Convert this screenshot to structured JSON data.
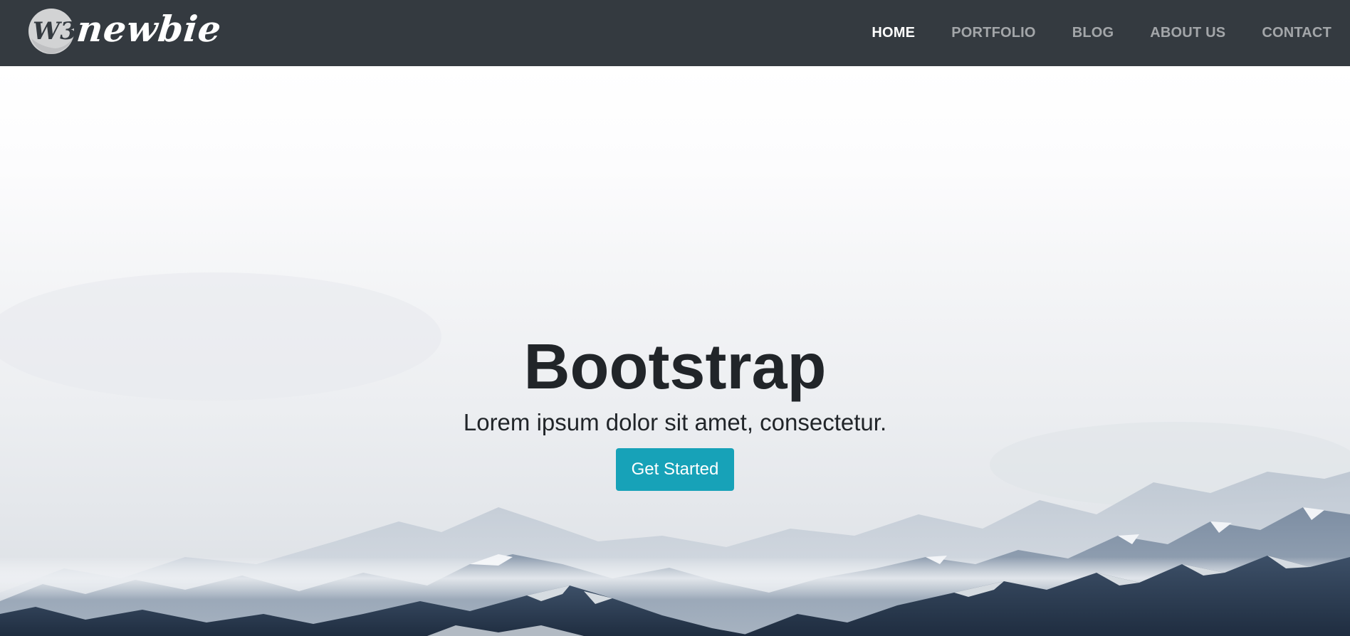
{
  "brand": {
    "name": "newbie",
    "logo_mark": "W3",
    "logo_icon": "w3newbie-logo-icon"
  },
  "nav": {
    "items": [
      {
        "label": "HOME",
        "active": true
      },
      {
        "label": "PORTFOLIO",
        "active": false
      },
      {
        "label": "BLOG",
        "active": false
      },
      {
        "label": "ABOUT US",
        "active": false
      },
      {
        "label": "CONTACT",
        "active": false
      }
    ]
  },
  "hero": {
    "title": "Bootstrap",
    "subtitle": "Lorem ipsum dolor sit amet, consectetur.",
    "cta_label": "Get Started",
    "background": "snowy-mountains-image"
  },
  "colors": {
    "navbar_bg": "#343a40",
    "nav_active": "#ffffff",
    "nav_inactive": "#a3a6a9",
    "cta_bg": "#17a2b8",
    "heading": "#212529"
  }
}
